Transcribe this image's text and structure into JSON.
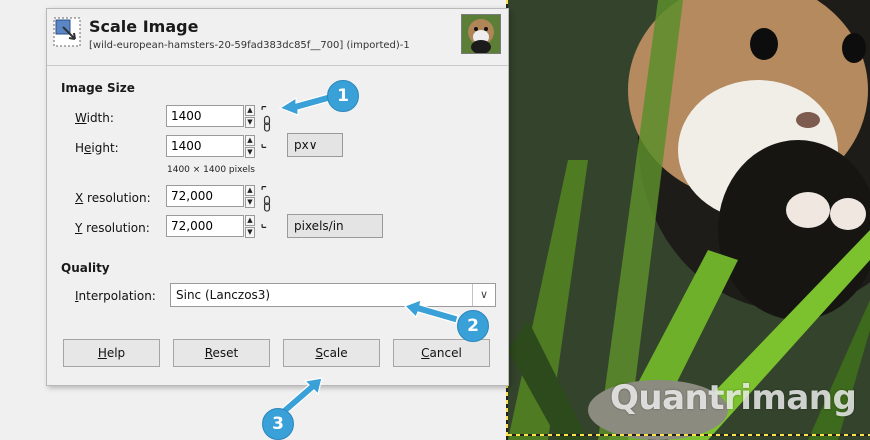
{
  "dialog": {
    "title": "Scale Image",
    "subtitle": "[wild-european-hamsters-20-59fad383dc85f__700] (imported)-1"
  },
  "image_size": {
    "heading": "Image Size",
    "width_label_u": "W",
    "width_label_rest": "idth:",
    "width_value": "1400",
    "height_label_pre": "H",
    "height_label_u": "e",
    "height_label_rest": "ight:",
    "height_value": "1400",
    "unit": "px",
    "unit_arrow": "∨",
    "pixels_note": "1400 × 1400 pixels",
    "xres_label_u": "X",
    "xres_label_rest": " resolution:",
    "xres_value": "72,000",
    "yres_label_u": "Y",
    "yres_label_rest": " resolution:",
    "yres_value": "72,000",
    "res_unit": "pixels/in"
  },
  "quality": {
    "heading": "Quality",
    "interp_label_u": "I",
    "interp_label_rest": "nterpolation:",
    "interp_value": "Sinc (Lanczos3)",
    "dropdown_arrow": "∨"
  },
  "buttons": {
    "help_u": "H",
    "help_rest": "elp",
    "reset_u": "R",
    "reset_rest": "eset",
    "scale_u": "S",
    "scale_rest": "cale",
    "cancel_u": "C",
    "cancel_rest": "ancel"
  },
  "callouts": [
    "1",
    "2",
    "3"
  ],
  "watermark": "Quantrimang",
  "colors": {
    "callout": "#3aa0d8",
    "dialog_bg": "#f0f0f0"
  }
}
